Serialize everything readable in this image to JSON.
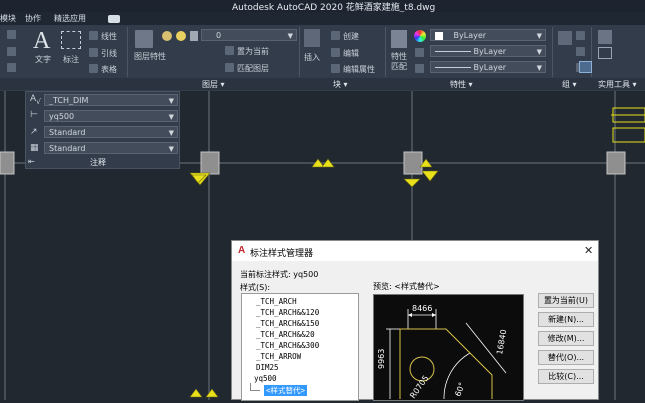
{
  "window": {
    "title": "Autodesk AutoCAD 2020    花鲜酒家建施_t8.dwg"
  },
  "menu": {
    "items": [
      "模块",
      "协作",
      "精选应用"
    ]
  },
  "ribbon": {
    "annotate_tools": [
      "文字",
      "标注",
      "线性",
      "引线",
      "表格"
    ],
    "layer_tools": [
      "图层特性",
      "置为当前",
      "匹配图层"
    ],
    "layer_combo": "0",
    "insert_label": "插入",
    "block_tools": [
      "创建",
      "编辑",
      "编辑属性"
    ],
    "match_label": "特性匹配",
    "prop_combos": [
      "ByLayer",
      "ByLayer",
      "ByLayer"
    ],
    "panel_labels": {
      "layers": "图层 ▾",
      "block": "块 ▾",
      "properties": "特性 ▾",
      "group": "组 ▾",
      "utilities": "实用工具 ▾"
    }
  },
  "annotation_panel": {
    "combos": [
      "_TCH_DIM",
      "yq500",
      "Standard",
      "Standard"
    ],
    "footer": "注释"
  },
  "dialog": {
    "title": "标注样式管理器",
    "current_style": "当前标注样式: yq500",
    "styles_label": "样式(S):",
    "preview_label": "预览: <样式替代>",
    "styles": [
      "_TCH_ARCH",
      "_TCH_ARCH&&120",
      "_TCH_ARCH&&150",
      "_TCH_ARCH&&20",
      "_TCH_ARCH&&300",
      "_TCH_ARROW",
      "DIM25",
      "yq500"
    ],
    "override": "<样式替代>",
    "buttons": [
      "置为当前(U)",
      "新建(N)...",
      "修改(M)...",
      "替代(O)...",
      "比较(C)..."
    ],
    "preview_dims": {
      "top": "8466",
      "left": "9963",
      "right": "16840",
      "radius": "R0705",
      "angle": "60°"
    }
  },
  "colors": {
    "ribbon_bg": "#333c4a",
    "drawing_bg": "#212830",
    "accent": "#e8e01a",
    "dialog_bg": "#f0f0f0",
    "selected": "#3399ff"
  }
}
